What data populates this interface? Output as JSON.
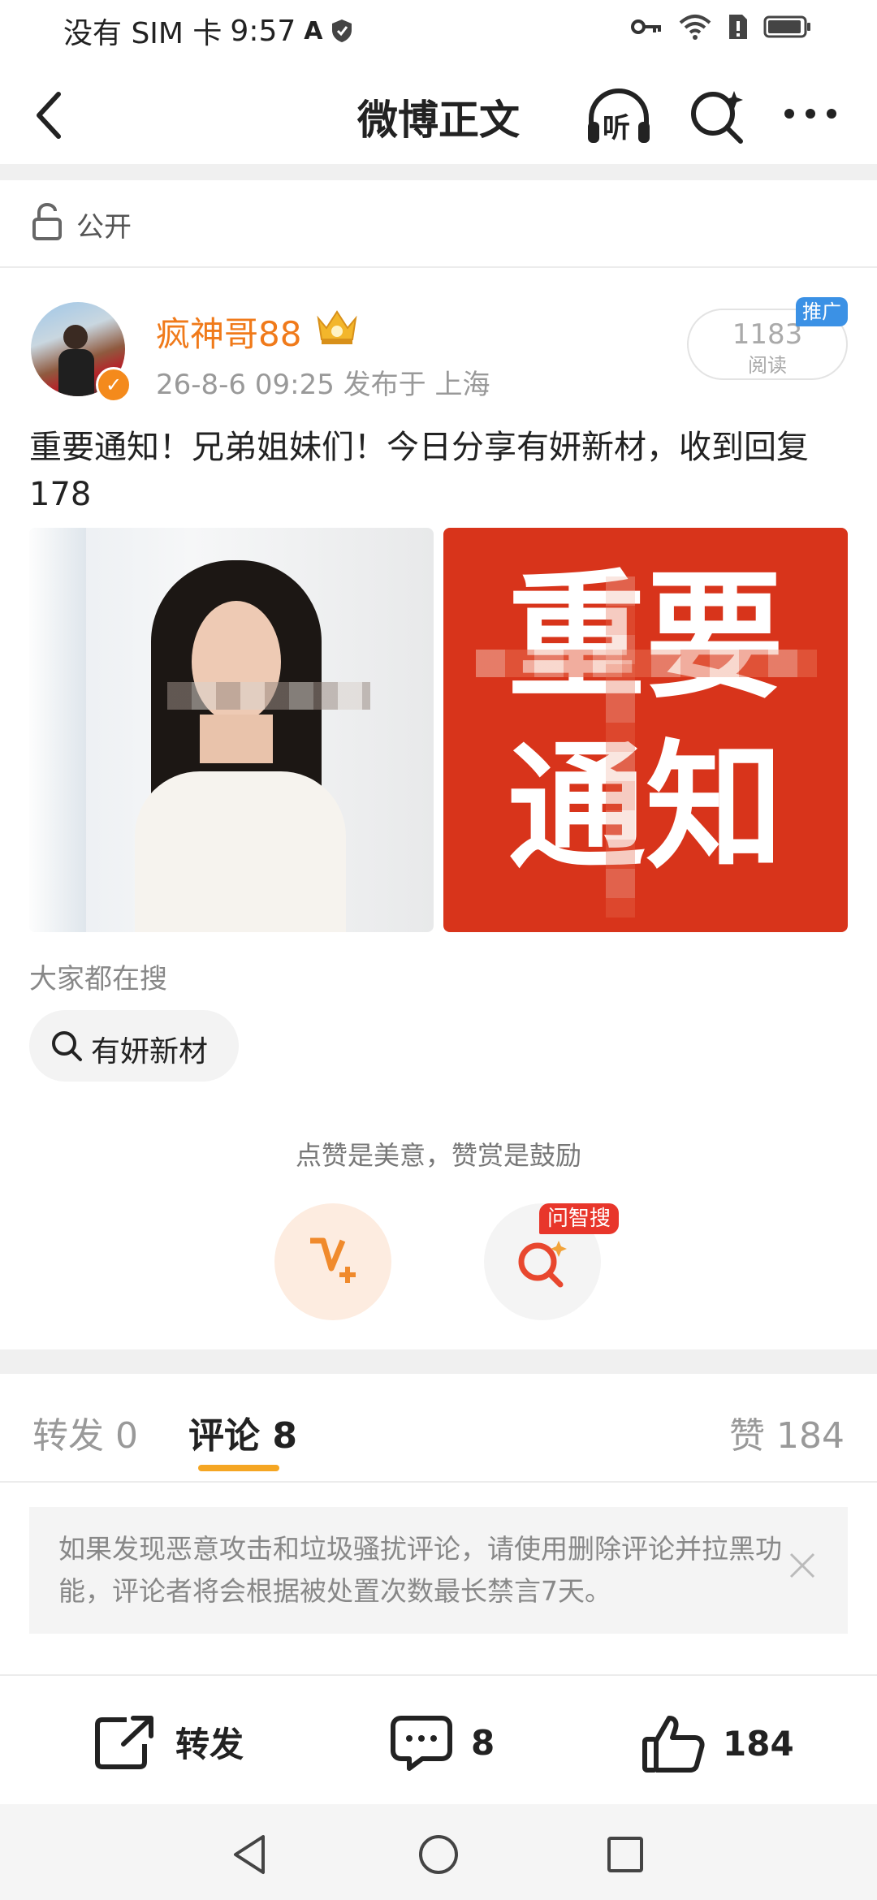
{
  "status_bar": {
    "carrier": "没有 SIM 卡",
    "time": "9:57"
  },
  "nav": {
    "title": "微博正文",
    "listen_label": "听"
  },
  "visibility": {
    "label": "公开"
  },
  "author": {
    "name": "疯神哥88",
    "meta": "26-8-6 09:25   发布于 上海",
    "reads_count": "1183",
    "reads_label": "阅读",
    "ad_tag": "推广"
  },
  "post": {
    "text": "重要通知！兄弟姐妹们！今日分享有妍新材，收到回复178",
    "image2_line1": "重要",
    "image2_line2": "通知"
  },
  "search": {
    "label": "大家都在搜",
    "chip": "有妍新材"
  },
  "reward": {
    "tip": "点赞是美意，赞赏是鼓励",
    "ai_tag": "问智搜"
  },
  "tabs": {
    "repost": "转发 0",
    "comment": "评论 8",
    "like": "赞 184"
  },
  "notice": {
    "text": "如果发现恶意攻击和垃圾骚扰评论，请使用删除评论并拉黑功能，评论者将会根据被处置次数最长禁言7天。"
  },
  "bottom_bar": {
    "repost_label": "转发",
    "comment_count": "8",
    "like_count": "184"
  },
  "colors": {
    "accent": "#f07a1a",
    "tab_underline": "#f5a623",
    "ad_blue": "#3b91e5",
    "red": "#d8341b"
  }
}
